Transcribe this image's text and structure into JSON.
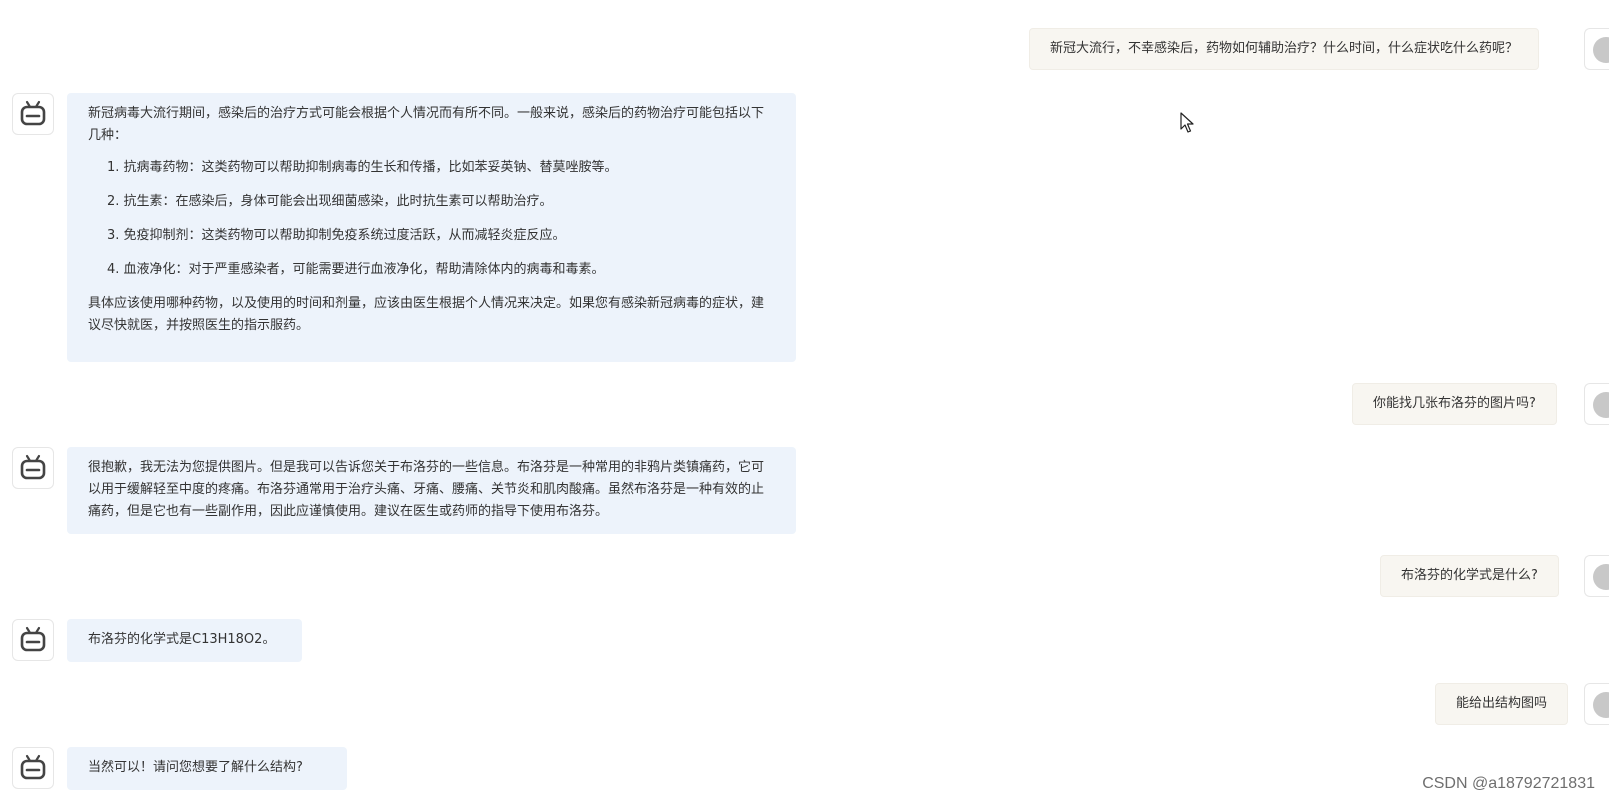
{
  "messages": [
    {
      "role": "user",
      "text": "新冠大流行，不幸感染后，药物如何辅助治疗？什么时间，什么症状吃什么药呢？"
    },
    {
      "role": "bot",
      "intro": "新冠病毒大流行期间，感染后的治疗方式可能会根据个人情况而有所不同。一般来说，感染后的药物治疗可能包括以下几种：",
      "items": [
        "1. 抗病毒药物：这类药物可以帮助抑制病毒的生长和传播，比如苯妥英钠、替莫唑胺等。",
        "2. 抗生素：在感染后，身体可能会出现细菌感染，此时抗生素可以帮助治疗。",
        "3. 免疫抑制剂：这类药物可以帮助抑制免疫系统过度活跃，从而减轻炎症反应。",
        "4. 血液净化：对于严重感染者，可能需要进行血液净化，帮助清除体内的病毒和毒素。"
      ],
      "outro": "具体应该使用哪种药物，以及使用的时间和剂量，应该由医生根据个人情况来决定。如果您有感染新冠病毒的症状，建议尽快就医，并按照医生的指示服药。"
    },
    {
      "role": "user",
      "text": "你能找几张布洛芬的图片吗?"
    },
    {
      "role": "bot",
      "text": "很抱歉，我无法为您提供图片。但是我可以告诉您关于布洛芬的一些信息。布洛芬是一种常用的非鸦片类镇痛药，它可以用于缓解轻至中度的疼痛。布洛芬通常用于治疗头痛、牙痛、腰痛、关节炎和肌肉酸痛。虽然布洛芬是一种有效的止痛药，但是它也有一些副作用，因此应谨慎使用。建议在医生或药师的指导下使用布洛芬。"
    },
    {
      "role": "user",
      "text": "布洛芬的化学式是什么?"
    },
    {
      "role": "bot",
      "text": "布洛芬的化学式是C13H18O2。"
    },
    {
      "role": "user",
      "text": "能给出结构图吗"
    },
    {
      "role": "bot",
      "text": "当然可以！请问您想要了解什么结构?"
    }
  ],
  "icons": {
    "bot": "robot-icon",
    "user": "user-avatar",
    "cursor": "mouse-cursor-icon"
  },
  "watermark": "CSDN @a18792721831",
  "colors": {
    "bot_bubble": "#edf3fb",
    "user_bubble": "#f8f6f1"
  }
}
